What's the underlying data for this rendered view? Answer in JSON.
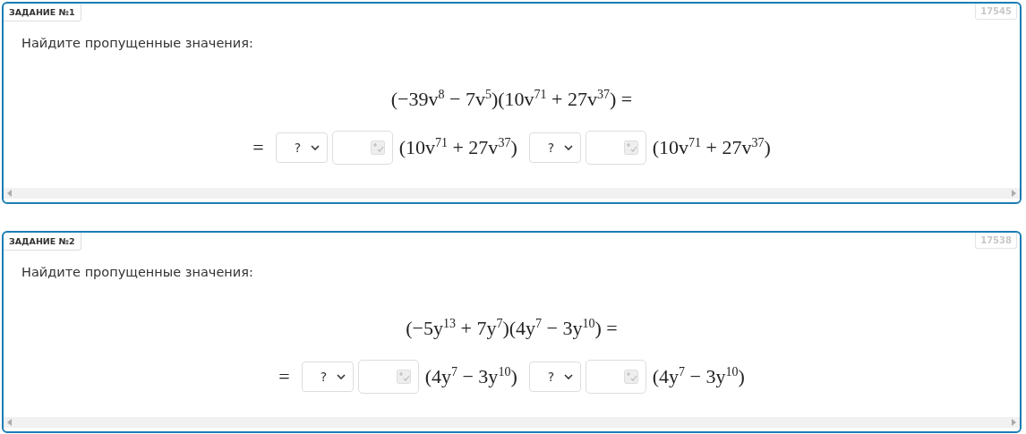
{
  "tasks": [
    {
      "label": "ЗАДАНИЕ №1",
      "number": "17545",
      "prompt": "Найдите пропущенные значения:",
      "equation": "(−39v$^{8}$ − 7v$^{5}$)(10v$^{71}$ + 27v$^{37}$) =",
      "lead": "=",
      "parts": [
        {
          "select": "?",
          "factor": "(10v$^{71}$ + 27v$^{37}$)"
        },
        {
          "select": "?",
          "factor": "(10v$^{71}$ + 27v$^{37}$)"
        }
      ]
    },
    {
      "label": "ЗАДАНИЕ №2",
      "number": "17538",
      "prompt": "Найдите пропущенные значения:",
      "equation": "(−5y$^{13}$ + 7y$^{7}$)(4y$^{7}$ − 3y$^{10}$) =",
      "lead": "=",
      "parts": [
        {
          "select": "?",
          "factor": "(4y$^{7}$ − 3y$^{10}$)"
        },
        {
          "select": "?",
          "factor": "(4y$^{7}$ − 3y$^{10}$)"
        }
      ]
    }
  ]
}
